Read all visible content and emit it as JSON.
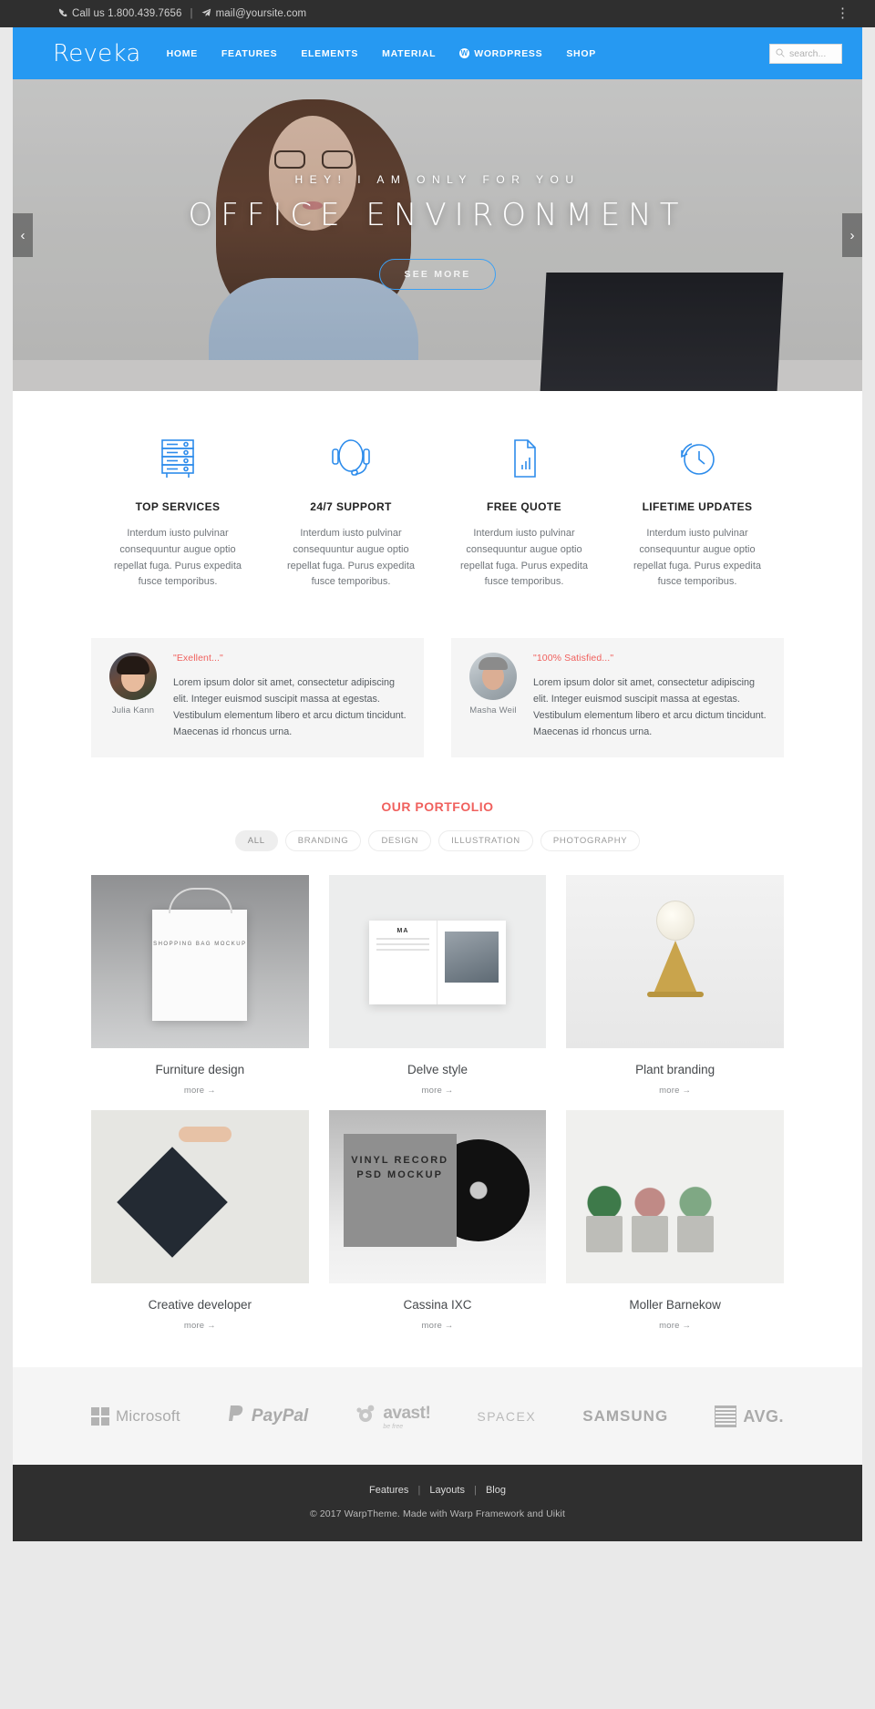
{
  "topbar": {
    "phone_icon": "phone-icon",
    "phone_text": "Call us 1.800.439.7656",
    "separator": "|",
    "mail_icon": "paper-plane-icon",
    "email": "mail@yoursite.com",
    "menu_icon": "kebab-menu-icon"
  },
  "header": {
    "logo": "Reveka",
    "nav": [
      {
        "label": "HOME",
        "active": true
      },
      {
        "label": "FEATURES",
        "active": false
      },
      {
        "label": "ELEMENTS",
        "active": false
      },
      {
        "label": "MATERIAL",
        "active": false
      },
      {
        "label": "WORDPRESS",
        "active": false,
        "icon": "wordpress-icon"
      },
      {
        "label": "SHOP",
        "active": false
      }
    ],
    "search": {
      "placeholder": "search...",
      "value": "",
      "icon": "search-icon"
    },
    "background": "#2699f2"
  },
  "hero": {
    "subtitle": "HEY! I AM ONLY FOR YOU",
    "title": "OFFICE ENVIRONMENT",
    "button": "SEE MORE",
    "prev": "‹",
    "next": "›"
  },
  "services": [
    {
      "icon": "server-rack-icon",
      "title": "TOP SERVICES",
      "text": "Interdum iusto pulvinar consequuntur augue optio repellat fuga. Purus expedita fusce temporibus."
    },
    {
      "icon": "headset-icon",
      "title": "24/7 SUPPORT",
      "text": "Interdum iusto pulvinar consequuntur augue optio repellat fuga. Purus expedita fusce temporibus."
    },
    {
      "icon": "document-chart-icon",
      "title": "FREE QUOTE",
      "text": "Interdum iusto pulvinar consequuntur augue optio repellat fuga. Purus expedita fusce temporibus."
    },
    {
      "icon": "clock-refresh-icon",
      "title": "LIFETIME UPDATES",
      "text": "Interdum iusto pulvinar consequuntur augue optio repellat fuga. Purus expedita fusce temporibus."
    }
  ],
  "testimonials": [
    {
      "avatar": "female-avatar",
      "name": "Julia Kann",
      "quote": "\"Exellent...\"",
      "text": "Lorem ipsum dolor sit amet, consectetur adipiscing elit. Integer euismod suscipit massa at egestas. Vestibulum elementum libero et arcu dictum tincidunt. Maecenas id rhoncus urna."
    },
    {
      "avatar": "male-avatar",
      "name": "Masha Weil",
      "quote": "\"100% Satisfied...\"",
      "text": "Lorem ipsum dolor sit amet, consectetur adipiscing elit. Integer euismod suscipit massa at egestas. Vestibulum elementum libero et arcu dictum tincidunt. Maecenas id rhoncus urna."
    }
  ],
  "portfolio": {
    "title": "OUR PORTFOLIO",
    "accent": "#f0615e",
    "filters": [
      {
        "label": "ALL",
        "active": true
      },
      {
        "label": "BRANDING",
        "active": false
      },
      {
        "label": "DESIGN",
        "active": false
      },
      {
        "label": "ILLUSTRATION",
        "active": false
      },
      {
        "label": "PHOTOGRAPHY",
        "active": false
      }
    ],
    "more_label": "more →",
    "items": [
      {
        "name": "Furniture design",
        "art": "shopping-bag-mockup",
        "caption": "SHOPPING BAG MOCKUP"
      },
      {
        "name": "Delve style",
        "art": "open-magazine-mockup",
        "caption": "MA"
      },
      {
        "name": "Plant branding",
        "art": "edison-bulb-lamp"
      },
      {
        "name": "Creative developer",
        "art": "black-tote-bag"
      },
      {
        "name": "Cassina IXC",
        "art": "vinyl-record-mockup",
        "caption": "VINYL RECORD PSD MOCKUP"
      },
      {
        "name": "Moller Barnekow",
        "art": "succulent-planters"
      }
    ]
  },
  "brands": [
    {
      "name": "Microsoft",
      "icon": "microsoft-logo"
    },
    {
      "name": "PayPal",
      "icon": "paypal-logo"
    },
    {
      "name": "avast!",
      "tagline": "be free",
      "icon": "avast-logo"
    },
    {
      "name": "SPACEX",
      "icon": "spacex-logo"
    },
    {
      "name": "SAMSUNG",
      "icon": "samsung-logo"
    },
    {
      "name": "AVG.",
      "icon": "avg-logo"
    }
  ],
  "footer": {
    "links": [
      "Features",
      "Layouts",
      "Blog"
    ],
    "separator": "|",
    "copyright": "© 2017 WarpTheme. Made with Warp Framework and Uikit"
  }
}
